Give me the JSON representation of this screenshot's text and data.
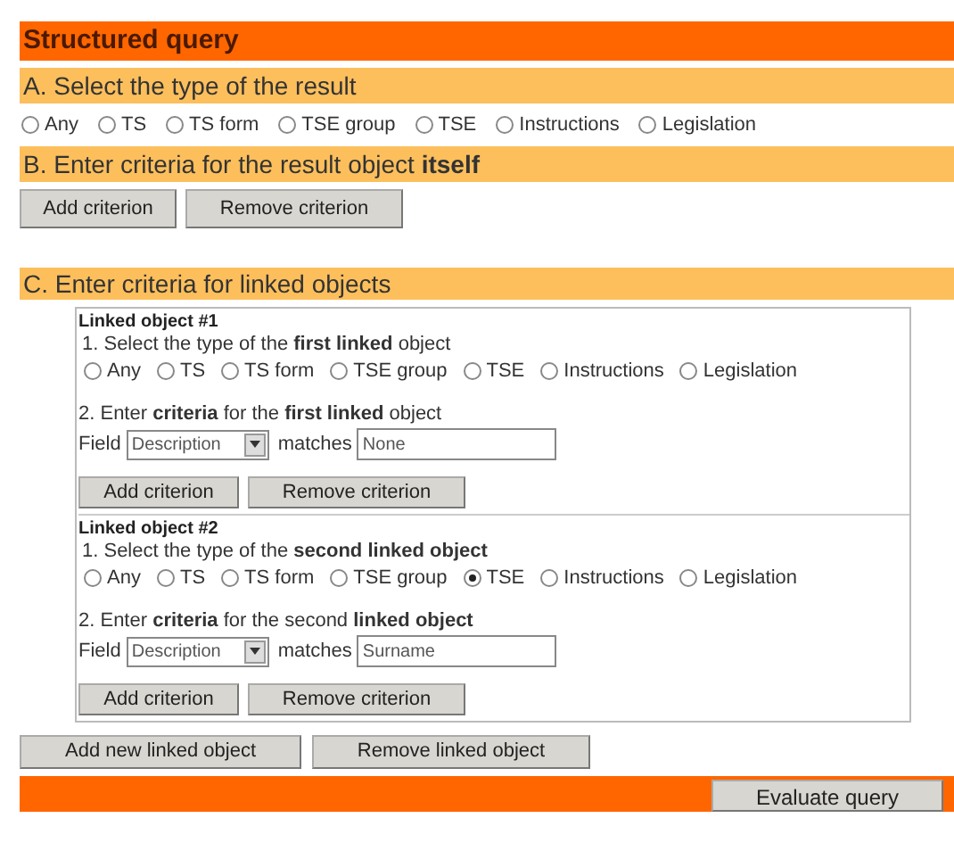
{
  "title": "Structured query",
  "section_a": {
    "heading": "A. Select the type of the result",
    "types": [
      {
        "label": "Any",
        "selected": false
      },
      {
        "label": "TS",
        "selected": false
      },
      {
        "label": "TS form",
        "selected": false
      },
      {
        "label": "TSE group",
        "selected": false
      },
      {
        "label": "TSE",
        "selected": false
      },
      {
        "label": "Instructions",
        "selected": false
      },
      {
        "label": "Legislation",
        "selected": false
      }
    ]
  },
  "section_b": {
    "heading": "B. Enter criteria for the result object **itself**",
    "buttons": [
      "Add criterion",
      "Remove criterion"
    ]
  },
  "section_c": {
    "heading": "C. Enter criteria for linked objects",
    "linked_objects": [
      {
        "title": "Linked object #1",
        "step_1": "1. Select the type of the **first linked** object",
        "types": [
          {
            "label": "Any",
            "selected": false
          },
          {
            "label": "TS",
            "selected": false
          },
          {
            "label": "TS form",
            "selected": false
          },
          {
            "label": "TSE group",
            "selected": false
          },
          {
            "label": "TSE",
            "selected": false
          },
          {
            "label": "Instructions",
            "selected": false
          },
          {
            "label": "Legislation",
            "selected": false
          }
        ],
        "step_2": "2. Enter **criteria** for the **first linked** object",
        "field_label": "Field",
        "field_value": "Description",
        "matches_label": "matches",
        "matches_value": "None",
        "buttons": [
          "Add criterion",
          "Remove criterion"
        ]
      },
      {
        "title": "Linked object #2",
        "step_1": "1. Select the type of the **second linked object**",
        "types": [
          {
            "label": "Any",
            "selected": false
          },
          {
            "label": "TS",
            "selected": false
          },
          {
            "label": "TS form",
            "selected": false
          },
          {
            "label": "TSE group",
            "selected": false
          },
          {
            "label": "TSE",
            "selected": true
          },
          {
            "label": "Instructions",
            "selected": false
          },
          {
            "label": "Legislation",
            "selected": false
          }
        ],
        "step_2": "2. Enter **criteria** for the second **linked object**",
        "field_label": "Field",
        "field_value": "Description",
        "matches_label": "matches",
        "matches_value": "Surname",
        "buttons": [
          "Add criterion",
          "Remove criterion"
        ]
      }
    ],
    "buttons": [
      "Add new linked object",
      "Remove linked object"
    ]
  },
  "footer": {
    "button": "Evaluate query"
  }
}
